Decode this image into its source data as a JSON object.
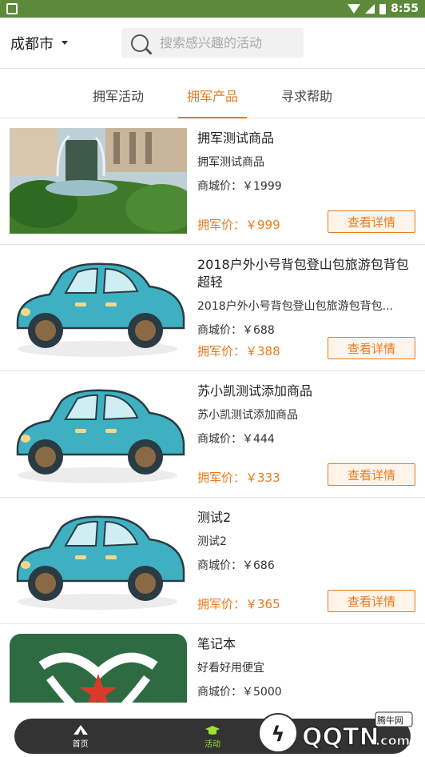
{
  "status": {
    "time": "8:55"
  },
  "header": {
    "city": "成都市",
    "search_placeholder": "搜索感兴趣的活动"
  },
  "tabs": [
    {
      "label": "拥军活动"
    },
    {
      "label": "拥军产品"
    },
    {
      "label": "寻求帮助"
    }
  ],
  "products": [
    {
      "name": "拥军测试商品",
      "desc": "拥军测试商品",
      "mall_price": "商城价：￥1999",
      "army_price": "拥军价：￥999",
      "button": "查看详情",
      "thumb": "garden-fountain-photo"
    },
    {
      "name": "2018户外小号背包登山包旅游包背包超轻",
      "desc": "2018户外小号背包登山包旅游包背包...",
      "mall_price": "商城价：￥688",
      "army_price": "拥军价：￥388",
      "button": "查看详情",
      "thumb": "car-illustration"
    },
    {
      "name": "苏小凯测试添加商品",
      "desc": "苏小凯测试添加商品",
      "mall_price": "商城价：￥444",
      "army_price": "拥军价：￥333",
      "button": "查看详情",
      "thumb": "car-illustration"
    },
    {
      "name": "测试2",
      "desc": "测试2",
      "mall_price": "商城价：￥686",
      "army_price": "拥军价：￥365",
      "button": "查看详情",
      "thumb": "car-illustration"
    },
    {
      "name": "笔记本",
      "desc": "好看好用便宜",
      "mall_price": "商城价：￥5000",
      "army_price": "",
      "button": "",
      "thumb": "star-heart-logo"
    }
  ],
  "bottom_nav": [
    {
      "label": "首页",
      "icon": "tent-icon"
    },
    {
      "label": "活动",
      "icon": "hat-icon"
    }
  ],
  "watermark": {
    "text": "QQTN.com",
    "badge": "腾牛网"
  },
  "colors": {
    "accent": "#e87a1c",
    "status_bar": "#5d8a3a",
    "nav_active": "#9be23a"
  }
}
